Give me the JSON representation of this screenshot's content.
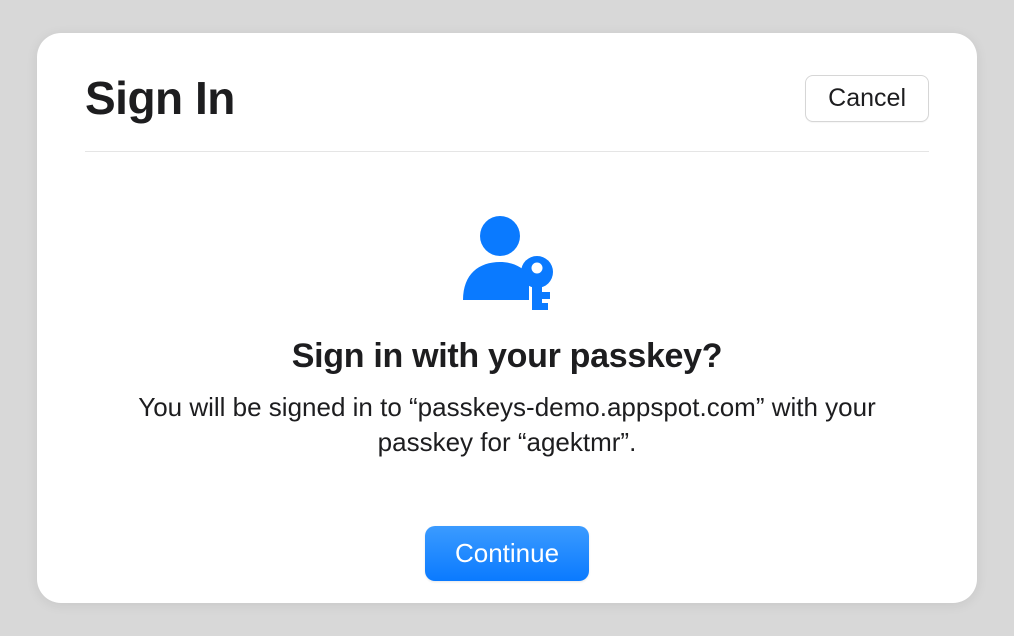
{
  "dialog": {
    "title": "Sign In",
    "cancel_label": "Cancel",
    "prompt_title": "Sign in with your passkey?",
    "prompt_description": "You will be signed in to “passkeys-demo.appspot.com” with your passkey for “agektmr”.",
    "continue_label": "Continue",
    "accent_color": "#0a7aff"
  }
}
